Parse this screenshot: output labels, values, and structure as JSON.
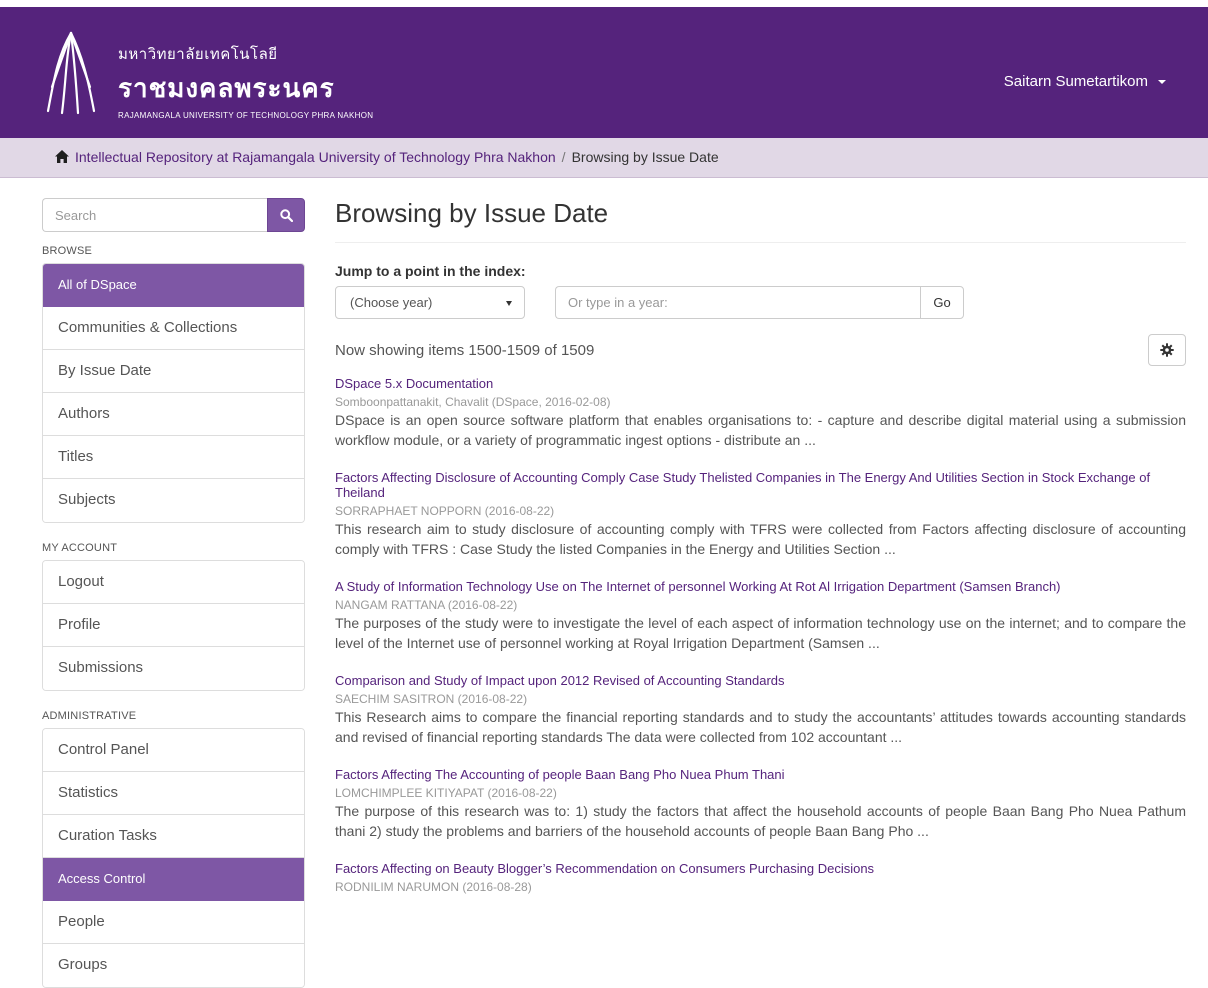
{
  "header": {
    "logo_thai_small": "มหาวิทยาลัยเทคโนโลยี",
    "logo_thai_big": "ราชมงคลพระนคร",
    "logo_eng": "RAJAMANGALA UNIVERSITY OF TECHNOLOGY PHRA NAKHON",
    "user_name": "Saitarn Sumetartikom"
  },
  "breadcrumb": {
    "home": "Intellectual Repository at Rajamangala University of Technology Phra Nakhon",
    "separator": "/",
    "current": "Browsing by Issue Date"
  },
  "sidebar": {
    "search_placeholder": "Search",
    "browse_label": "BROWSE",
    "browse_items": [
      {
        "label": "All of DSpace",
        "active": true
      },
      {
        "label": "Communities & Collections"
      },
      {
        "label": "By Issue Date"
      },
      {
        "label": "Authors"
      },
      {
        "label": "Titles"
      },
      {
        "label": "Subjects"
      }
    ],
    "account_label": "MY ACCOUNT",
    "account_items": [
      {
        "label": "Logout"
      },
      {
        "label": "Profile"
      },
      {
        "label": "Submissions"
      }
    ],
    "admin_label": "ADMINISTRATIVE",
    "admin_items": [
      {
        "label": "Control Panel"
      },
      {
        "label": "Statistics"
      },
      {
        "label": "Curation Tasks"
      },
      {
        "label": "Access Control",
        "active": true
      },
      {
        "label": "People"
      },
      {
        "label": "Groups"
      }
    ]
  },
  "main": {
    "title": "Browsing by Issue Date",
    "jump_label": "Jump to a point in the index:",
    "year_select": "(Choose year)",
    "year_input_placeholder": "Or type in a year:",
    "go_label": "Go",
    "showing": "Now showing items 1500-1509 of 1509",
    "results": [
      {
        "title": "DSpace 5.x Documentation",
        "meta": "Somboonpattanakit, Chavalit (DSpace, 2016-02-08)",
        "abstract": "DSpace is an open source software platform that enables organisations to:  - capture and describe digital material using a submission workflow module, or a variety of programmatic ingest options - distribute an ..."
      },
      {
        "title": "Factors Affecting Disclosure of Accounting Comply Case Study Thelisted Companies in The Energy And Utilities Section in Stock Exchange of Theiland",
        "meta": "SORRAPHAET NOPPORN (2016-08-22)",
        "abstract": "This research aim to study disclosure of accounting comply with TFRS were collected from Factors affecting disclosure of accounting comply with TFRS : Case Study the listed Companies in the Energy and Utilities Section ..."
      },
      {
        "title": "A Study of Information Technology Use on The Internet of personnel Working At Rot Al Irrigation Department (Samsen Branch)",
        "meta": "NANGAM RATTANA (2016-08-22)",
        "abstract": "The purposes of the study were to investigate the level of each aspect of information technology use on the internet; and to compare the level of the Internet use of personnel working at Royal Irrigation Department (Samsen ..."
      },
      {
        "title": "Comparison and Study of Impact upon 2012 Revised of Accounting Standards",
        "meta": "SAECHIM SASITRON (2016-08-22)",
        "abstract": "This Research aims to compare the financial reporting standards and to study the accountants’ attitudes towards accounting standards and revised of financial reporting standards The data were collected from 102 accountant ..."
      },
      {
        "title": "Factors Affecting The Accounting of people Baan Bang Pho Nuea Phum Thani",
        "meta": "LOMCHIMPLEE KITIYAPAT (2016-08-22)",
        "abstract": "The purpose of this research was to: 1) study the factors that affect the household accounts of people Baan Bang Pho Nuea Pathum thani 2) study the problems and barriers of the household accounts of people Baan Bang Pho ..."
      },
      {
        "title": "Factors Affecting on Beauty Blogger’s Recommendation on Consumers Purchasing Decisions",
        "meta": "RODNILIM NARUMON (2016-08-28)",
        "abstract": ""
      }
    ]
  },
  "colors": {
    "header_bg": "#55237c",
    "breadcrumb_bg": "#e1d8e6",
    "accent": "#7e57a5",
    "link": "#55237c"
  },
  "icons": {
    "home": "home-icon",
    "search": "search-icon",
    "caret": "caret-down-icon",
    "gear": "gear-icon",
    "logo": "university-logo-icon"
  }
}
